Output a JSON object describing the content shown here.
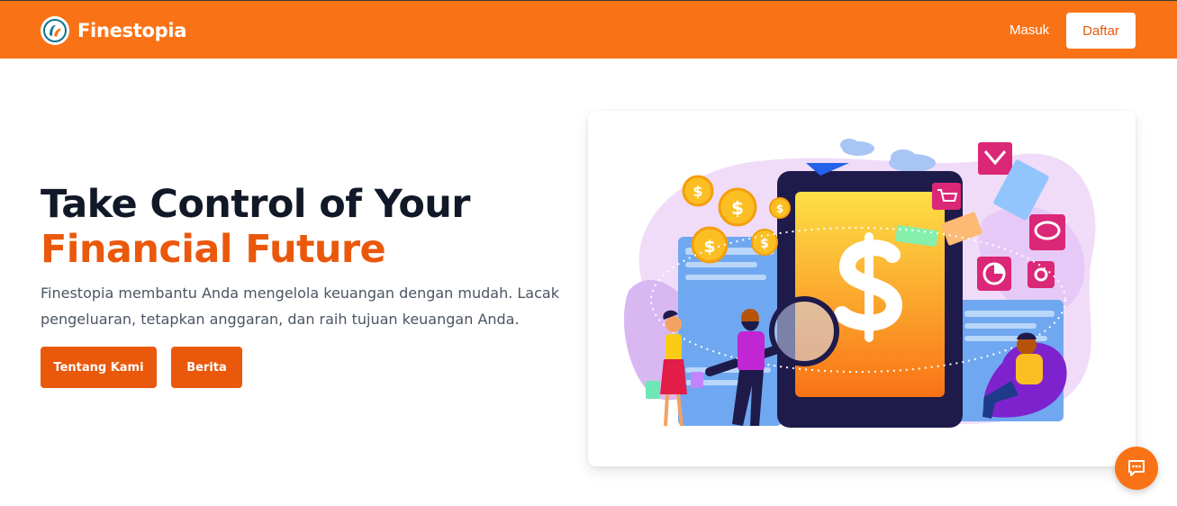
{
  "navbar": {
    "brand": "Finestopia",
    "logo_icon": "finestopia-logo-icon",
    "login_label": "Masuk",
    "register_label": "Daftar",
    "color": "#f97316"
  },
  "hero": {
    "title_line1": "Take Control of Your",
    "title_line2": "Financial Future",
    "description": "Finestopia membantu Anda mengelola keuangan dengan mudah. Lacak pengeluaran, tetapkan anggaran, dan raih tujuan keuangan Anda.",
    "buttons": {
      "about": "Tentang Kami",
      "news": "Berita"
    },
    "accent": "#ea580c"
  },
  "illustration": {
    "icons": [
      "dollar-icon",
      "shopping-cart-icon",
      "mail-icon",
      "chat-bubble-icon",
      "pie-chart-icon",
      "gear-icon",
      "magnifier-icon",
      "paper-plane-icon",
      "cloud-icon"
    ]
  },
  "chat": {
    "icon": "chat-icon"
  }
}
